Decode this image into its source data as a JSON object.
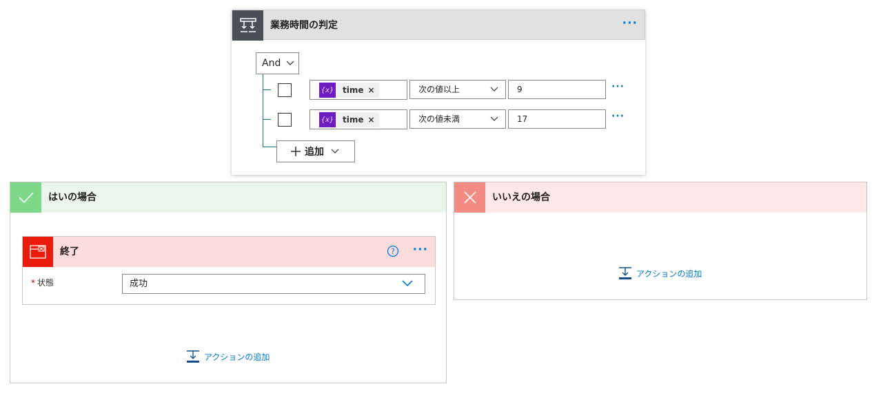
{
  "condition": {
    "title": "業務時間の判定",
    "more_label": "···",
    "group_operator": "And",
    "rows": [
      {
        "token": "time",
        "token_icon": "{x}",
        "remove": "×",
        "operator": "次の値以上",
        "value": "9",
        "more": "···"
      },
      {
        "token": "time",
        "token_icon": "{x}",
        "remove": "×",
        "operator": "次の値未満",
        "value": "17",
        "more": "···"
      }
    ],
    "add_label": "追加"
  },
  "yes_branch": {
    "title": "はいの場合",
    "action": {
      "title": "終了",
      "more_label": "···",
      "field_required_mark": "*",
      "field_label": "状態",
      "field_value": "成功"
    },
    "add_action_label": "アクションの追加"
  },
  "no_branch": {
    "title": "いいえの場合",
    "add_action_label": "アクションの追加"
  },
  "colors": {
    "accent": "#0078d4",
    "condition_icon_bg": "#484f58",
    "yes_icon_bg": "#7fd88a",
    "no_icon_bg": "#f28b82",
    "terminate_icon_bg": "#ea1a0d",
    "token_bg": "#6f1bc2"
  }
}
